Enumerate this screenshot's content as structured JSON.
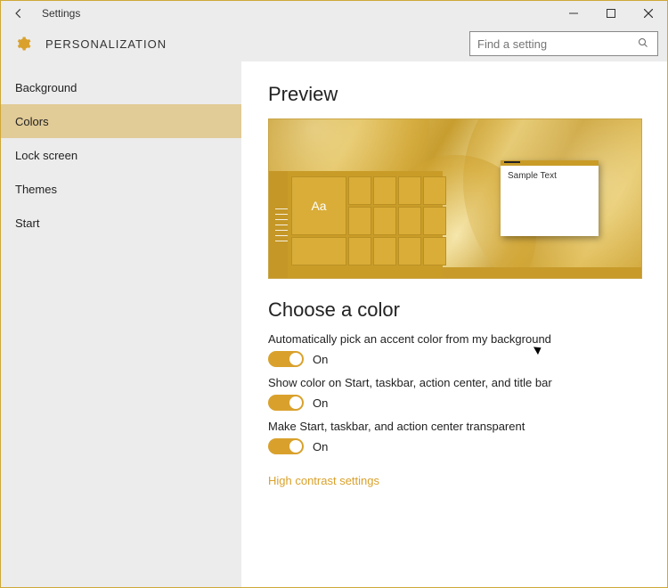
{
  "window": {
    "title": "Settings"
  },
  "header": {
    "title": "PERSONALIZATION"
  },
  "search": {
    "placeholder": "Find a setting"
  },
  "sidebar": {
    "items": [
      {
        "label": "Background",
        "selected": false
      },
      {
        "label": "Colors",
        "selected": true
      },
      {
        "label": "Lock screen",
        "selected": false
      },
      {
        "label": "Themes",
        "selected": false
      },
      {
        "label": "Start",
        "selected": false
      }
    ]
  },
  "content": {
    "preview_heading": "Preview",
    "preview_sample_text": "Sample Text",
    "preview_tile_text": "Aa",
    "choose_color_heading": "Choose a color",
    "options": [
      {
        "label": "Automatically pick an accent color from my background",
        "state": "On"
      },
      {
        "label": "Show color on Start, taskbar, action center, and title bar",
        "state": "On"
      },
      {
        "label": "Make Start, taskbar, and action center transparent",
        "state": "On"
      }
    ],
    "high_contrast_link": "High contrast settings"
  },
  "colors": {
    "accent": "#d9a12c"
  }
}
